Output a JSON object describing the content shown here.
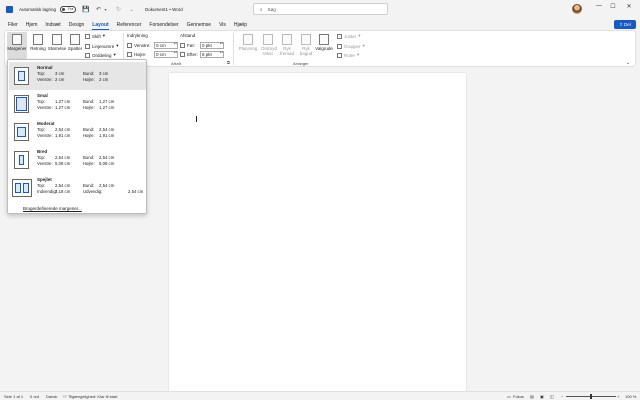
{
  "titlebar": {
    "autosave_label": "Automatisk lagring",
    "autosave_state": "Fra",
    "doc_title": "Dokument1 • Word",
    "search_placeholder": "Søg",
    "icons": [
      "word-icon",
      "save-icon",
      "undo-icon",
      "redo-icon",
      "search-icon",
      "minimize-icon",
      "maximize-icon",
      "close-icon"
    ]
  },
  "menu": {
    "tabs": [
      "Filer",
      "Hjem",
      "Indsæt",
      "Design",
      "Layout",
      "Referencer",
      "Forsendelser",
      "Gennemse",
      "Vis",
      "Hjælp"
    ],
    "active": "Layout",
    "share_label": "Del"
  },
  "ribbon": {
    "margins": "Margener",
    "orientation": "Retning",
    "size": "Størrelse",
    "columns": "Spalter",
    "breaks": "Skift",
    "line_numbers": "Linjenumre",
    "hyphenation": "Orddeling",
    "indent_title": "Indrykning",
    "indent_left_label": "Venstre:",
    "indent_left_value": "0 cm",
    "indent_right_label": "Højre:",
    "indent_right_value": "0 cm",
    "spacing_title": "Afstand",
    "spacing_before_label": "Før:",
    "spacing_before_value": "0 pkt",
    "spacing_after_label": "Efter:",
    "spacing_after_value": "8 pkt",
    "paragraph_group": "Afsnit",
    "position": "Placering",
    "wrap_text": "Ombryd tekst",
    "bring_forward": "Ryk fremad",
    "send_backward": "Ryk bagud",
    "selection_pane": "Valgrude",
    "align": "Juster",
    "group": "Grupper",
    "rotate": "Roter",
    "arrange_group": "Arranger"
  },
  "margins_menu": {
    "options": [
      {
        "name": "Normal",
        "r1a": "Top:",
        "r1b": "3 cm",
        "r1c": "Bund:",
        "r1d": "3 cm",
        "r2a": "Venstre:",
        "r2b": "2 cm",
        "r2c": "Højre:",
        "r2d": "2 cm"
      },
      {
        "name": "Smal",
        "r1a": "Top:",
        "r1b": "1,27 cm",
        "r1c": "Bund:",
        "r1d": "1,27 cm",
        "r2a": "Venstre:",
        "r2b": "1,27 cm",
        "r2c": "Højre:",
        "r2d": "1,27 cm"
      },
      {
        "name": "Moderat",
        "r1a": "Top:",
        "r1b": "2,54 cm",
        "r1c": "Bund:",
        "r1d": "2,54 cm",
        "r2a": "Venstre:",
        "r2b": "1,91 cm",
        "r2c": "Højre:",
        "r2d": "1,91 cm"
      },
      {
        "name": "Bred",
        "r1a": "Top:",
        "r1b": "2,54 cm",
        "r1c": "Bund:",
        "r1d": "2,54 cm",
        "r2a": "Venstre:",
        "r2b": "5,08 cm",
        "r2c": "Højre:",
        "r2d": "5,08 cm"
      },
      {
        "name": "Spejlet",
        "r1a": "Top:",
        "r1b": "2,54 cm",
        "r1c": "Bund:",
        "r1d": "2,54 cm",
        "r2a": "Indvendig:",
        "r2b": "3,18 cm",
        "r2c": "Udvendig:",
        "r2d": "2,54 cm"
      }
    ],
    "selected": "Normal",
    "custom_label": "Brugerdefinerede margener..."
  },
  "statusbar": {
    "page": "Side 1 af 1",
    "words": "0 ord",
    "language": "Dansk",
    "accessibility": "Tilgængelighed: Klar til start",
    "focus": "Fokus",
    "zoom": "100 %",
    "zoom_fraction": 0.5
  }
}
